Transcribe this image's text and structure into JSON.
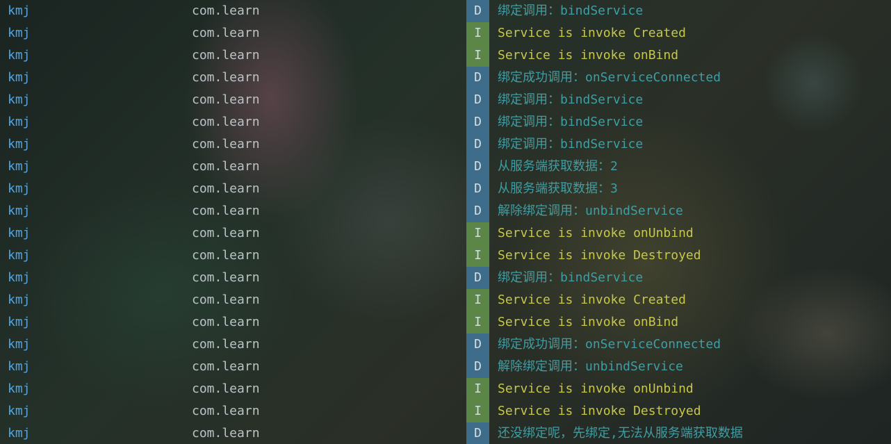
{
  "logcat": {
    "rows": [
      {
        "tag": "kmj",
        "package": "com.learn",
        "level": "D",
        "message": "绑定调用：bindService"
      },
      {
        "tag": "kmj",
        "package": "com.learn",
        "level": "I",
        "message": "Service is invoke Created"
      },
      {
        "tag": "kmj",
        "package": "com.learn",
        "level": "I",
        "message": "Service is invoke onBind"
      },
      {
        "tag": "kmj",
        "package": "com.learn",
        "level": "D",
        "message": "绑定成功调用：onServiceConnected"
      },
      {
        "tag": "kmj",
        "package": "com.learn",
        "level": "D",
        "message": "绑定调用：bindService"
      },
      {
        "tag": "kmj",
        "package": "com.learn",
        "level": "D",
        "message": "绑定调用：bindService"
      },
      {
        "tag": "kmj",
        "package": "com.learn",
        "level": "D",
        "message": "绑定调用：bindService"
      },
      {
        "tag": "kmj",
        "package": "com.learn",
        "level": "D",
        "message": "从服务端获取数据：2"
      },
      {
        "tag": "kmj",
        "package": "com.learn",
        "level": "D",
        "message": "从服务端获取数据：3"
      },
      {
        "tag": "kmj",
        "package": "com.learn",
        "level": "D",
        "message": "解除绑定调用：unbindService"
      },
      {
        "tag": "kmj",
        "package": "com.learn",
        "level": "I",
        "message": "Service is invoke onUnbind"
      },
      {
        "tag": "kmj",
        "package": "com.learn",
        "level": "I",
        "message": "Service is invoke Destroyed"
      },
      {
        "tag": "kmj",
        "package": "com.learn",
        "level": "D",
        "message": "绑定调用：bindService"
      },
      {
        "tag": "kmj",
        "package": "com.learn",
        "level": "I",
        "message": "Service is invoke Created"
      },
      {
        "tag": "kmj",
        "package": "com.learn",
        "level": "I",
        "message": "Service is invoke onBind"
      },
      {
        "tag": "kmj",
        "package": "com.learn",
        "level": "D",
        "message": "绑定成功调用：onServiceConnected"
      },
      {
        "tag": "kmj",
        "package": "com.learn",
        "level": "D",
        "message": "解除绑定调用：unbindService"
      },
      {
        "tag": "kmj",
        "package": "com.learn",
        "level": "I",
        "message": "Service is invoke onUnbind"
      },
      {
        "tag": "kmj",
        "package": "com.learn",
        "level": "I",
        "message": "Service is invoke Destroyed"
      },
      {
        "tag": "kmj",
        "package": "com.learn",
        "level": "D",
        "message": "还没绑定呢，先绑定,无法从服务端获取数据"
      }
    ]
  },
  "colors": {
    "tag": "#4fa6e6",
    "package": "#bcc3c6",
    "debug_badge": "#3d6d8a",
    "info_badge": "#5a8648",
    "debug_message": "#3f9ea3",
    "info_message": "#c6c74a"
  }
}
